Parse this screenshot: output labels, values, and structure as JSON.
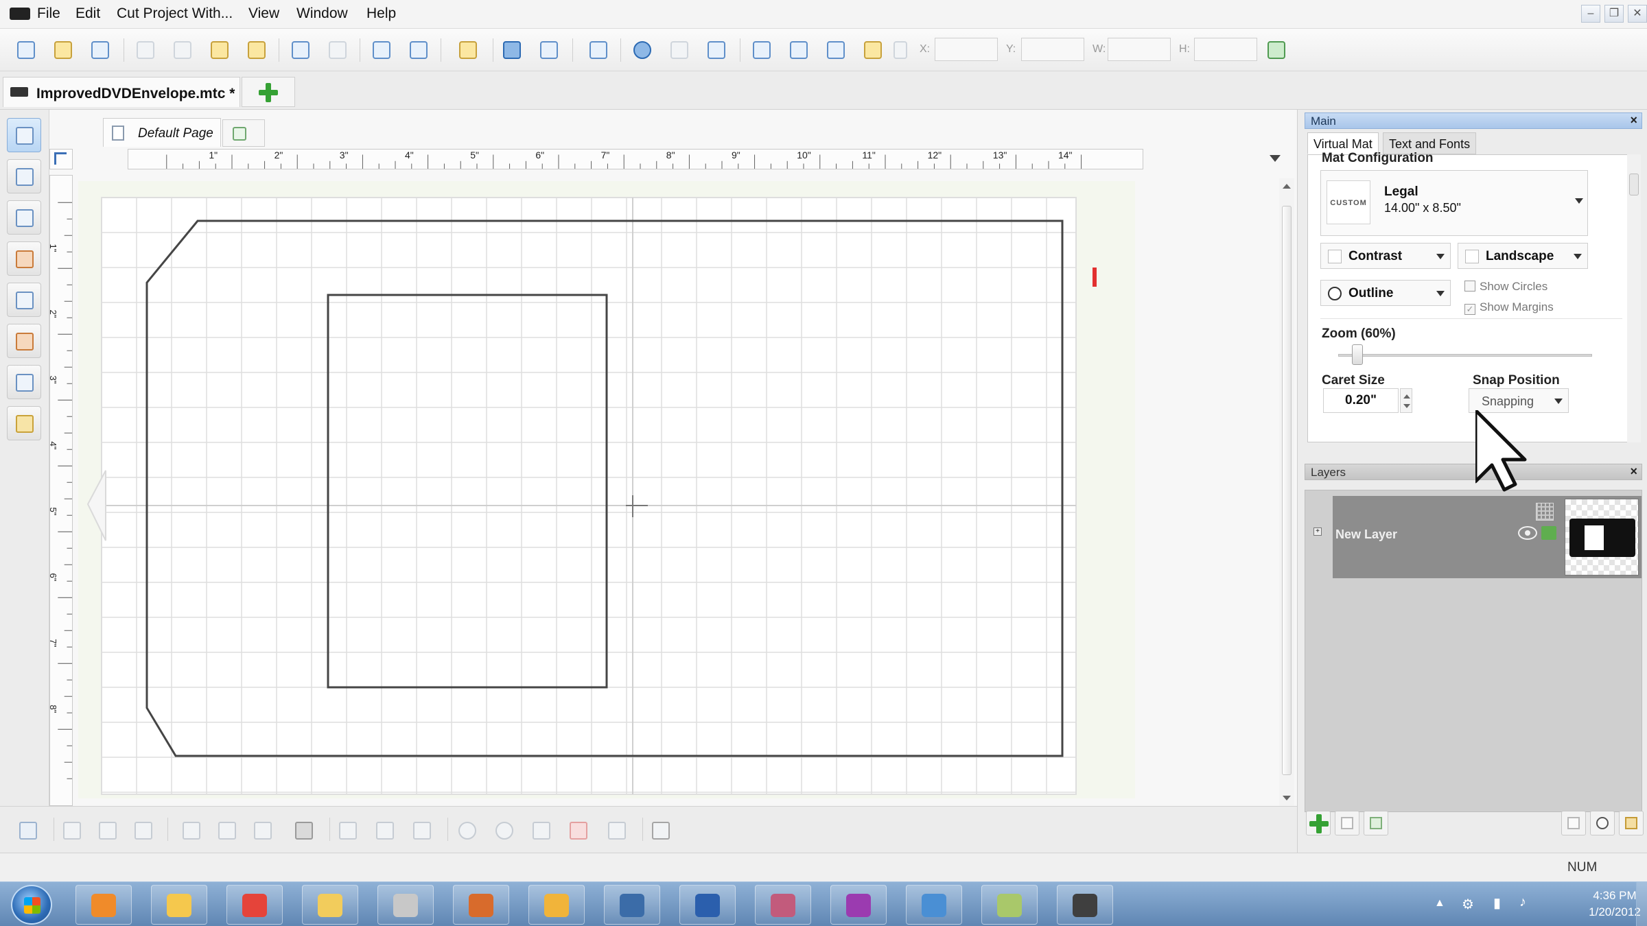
{
  "menubar": {
    "items": [
      "File",
      "Edit",
      "Cut Project With...",
      "View",
      "Window",
      "Help"
    ],
    "window_controls": [
      "–",
      "❐",
      "✕"
    ]
  },
  "toolbar": {
    "coords": [
      {
        "label": "X:",
        "value": ""
      },
      {
        "label": "Y:",
        "value": ""
      },
      {
        "label": "W:",
        "value": ""
      },
      {
        "label": "H:",
        "value": ""
      }
    ]
  },
  "document": {
    "tab_title": "ImprovedDVDEnvelope.mtc *",
    "page_tab": "Default Page"
  },
  "ruler": {
    "h_labels": [
      "1\"",
      "2\"",
      "3\"",
      "4\"",
      "5\"",
      "6\"",
      "7\"",
      "8\"",
      "9\"",
      "10\"",
      "11\"",
      "12\"",
      "13\"",
      "14\""
    ],
    "v_labels": [
      "1\"",
      "2\"",
      "3\"",
      "4\"",
      "5\"",
      "6\"",
      "7\"",
      "8\""
    ]
  },
  "main_panel": {
    "title": "Main",
    "tabs": [
      "Virtual Mat",
      "Text and Fonts"
    ],
    "active_tab": "Virtual Mat",
    "mat_configuration_label": "Mat Configuration",
    "mat_badge": "CUSTOM",
    "mat_name": "Legal",
    "mat_size": "14.00\" x 8.50\"",
    "contrast_label": "Contrast",
    "orientation_label": "Landscape",
    "outline_label": "Outline",
    "show_circles_label": "Show Circles",
    "show_circles_checked": false,
    "show_margins_label": "Show Margins",
    "show_margins_checked": true,
    "zoom_label": "Zoom (60%)",
    "zoom_percent": 60,
    "caret_size_label": "Caret Size",
    "caret_size_value": "0.20\"",
    "snap_position_label": "Snap Position",
    "snap_value": "Snapping"
  },
  "layers_panel": {
    "title": "Layers",
    "layers": [
      {
        "name": "New Layer",
        "visible": true,
        "locked": false
      }
    ]
  },
  "statusbar": {
    "num_lock": "NUM"
  },
  "taskbar": {
    "time": "4:36 PM",
    "date": "1/20/2012",
    "icons": [
      "media-player-icon",
      "outlook-icon",
      "chrome-icon",
      "explorer-icon",
      "mtc-icon",
      "pen-tool-icon",
      "paint-icon",
      "book-icon",
      "word-icon",
      "cutter-icon",
      "design-icon",
      "network-icon",
      "notes-icon",
      "camcorder-icon"
    ]
  },
  "colors": {
    "accent": "#3b6fb6",
    "panel_header": "#b6cfee",
    "taskbar": "#6f95c1",
    "add_green": "#35a134"
  }
}
